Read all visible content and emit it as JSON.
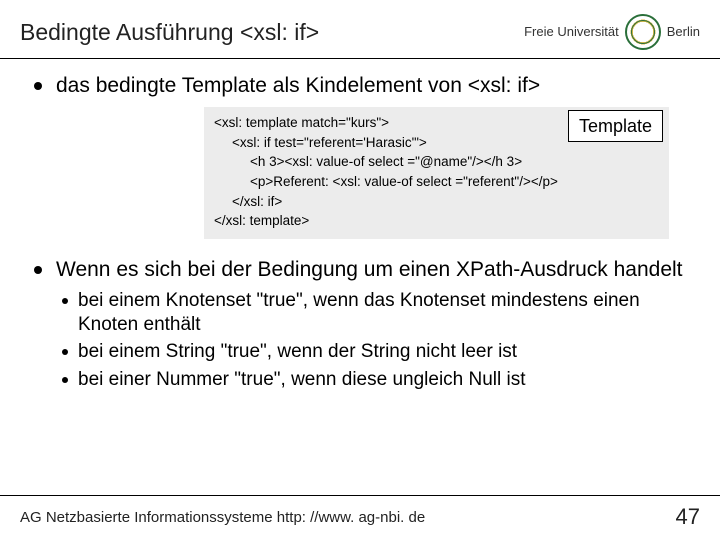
{
  "header": {
    "title": "Bedingte Ausführung <xsl: if>",
    "logo_line1": "Freie Universität",
    "logo_line2": "Berlin"
  },
  "bullets": {
    "b1": "das bedingte Template als Kindelement von <xsl: if>",
    "b2": "Wenn es sich bei der Bedingung um einen XPath-Ausdruck handelt"
  },
  "code": {
    "l1": "<xsl: template match=\"kurs\">",
    "l2": "<xsl: if test=\"referent='Harasic'\">",
    "l3": "<h 3><xsl: value-of select =\"@name\"/></h 3>",
    "l4": "<p>Referent:  <xsl: value-of select =\"referent\"/></p>",
    "l5": "</xsl: if>",
    "l6": "</xsl: template>",
    "badge": "Template"
  },
  "sub": {
    "s1": "bei einem Knotenset \"true\", wenn das Knotenset mindestens einen Knoten enthält",
    "s2": "bei einem String \"true\", wenn der String nicht leer ist",
    "s3": "bei einer Nummer \"true\", wenn diese ungleich Null ist"
  },
  "footer": {
    "left": "AG Netzbasierte Informationssysteme http: //www. ag-nbi. de",
    "page": "47"
  }
}
